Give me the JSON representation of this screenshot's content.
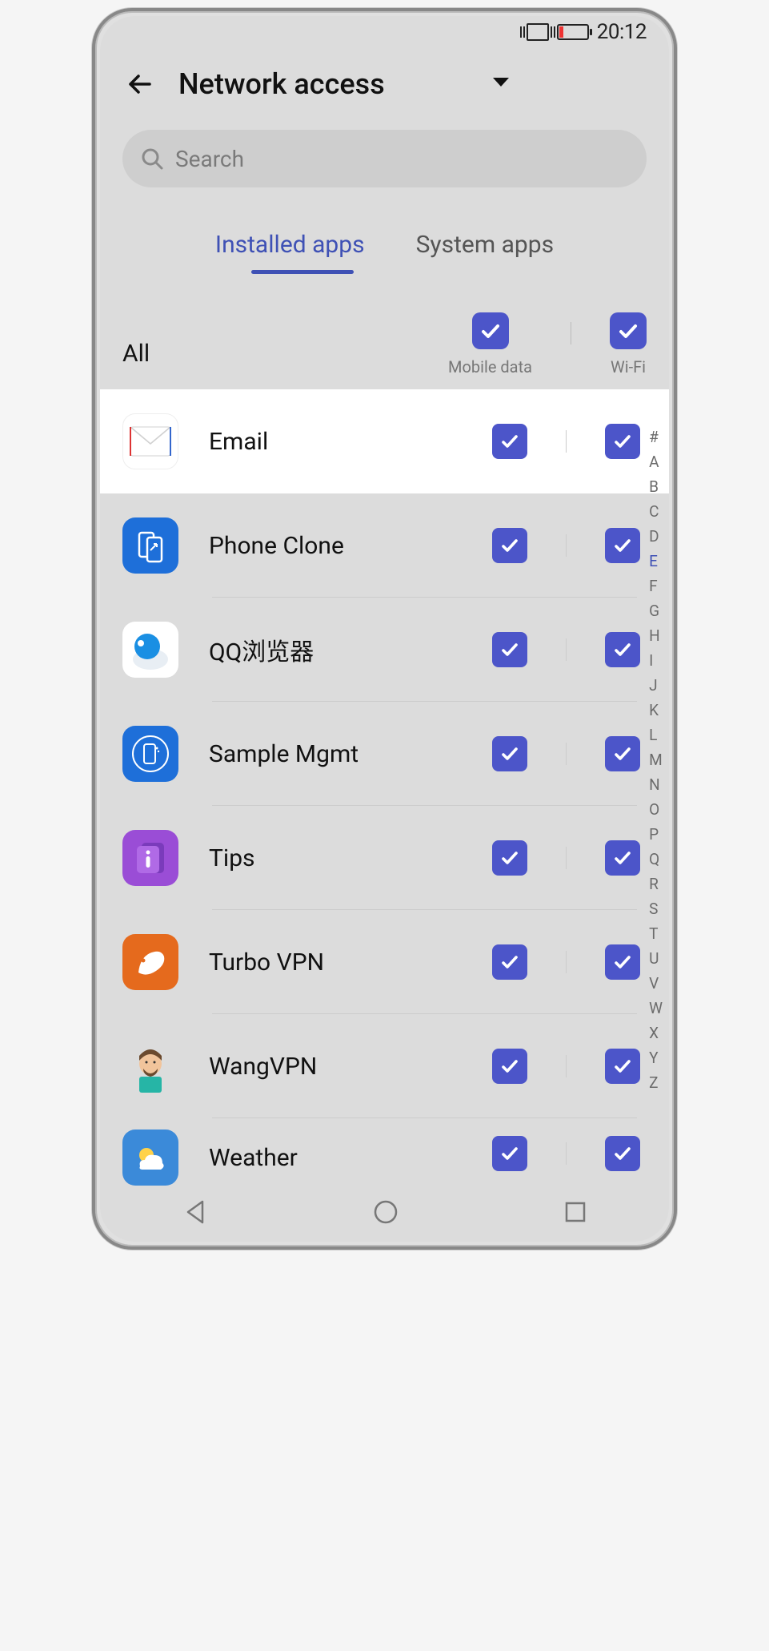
{
  "status": {
    "time": "20:12"
  },
  "header": {
    "title": "Network access"
  },
  "search": {
    "placeholder": "Search"
  },
  "tabs": {
    "installed": "Installed apps",
    "system": "System apps",
    "active": "installed"
  },
  "columns": {
    "all_label": "All",
    "mobile": "Mobile data",
    "wifi": "Wi-Fi",
    "all_mobile_checked": true,
    "all_wifi_checked": true
  },
  "apps": [
    {
      "name": "Email",
      "icon": "email",
      "mobile": true,
      "wifi": true,
      "highlight": true
    },
    {
      "name": "Phone Clone",
      "icon": "phoneclone",
      "mobile": true,
      "wifi": true
    },
    {
      "name": "QQ浏览器",
      "icon": "qq",
      "mobile": true,
      "wifi": true
    },
    {
      "name": "Sample Mgmt",
      "icon": "sample",
      "mobile": true,
      "wifi": true
    },
    {
      "name": "Tips",
      "icon": "tips",
      "mobile": true,
      "wifi": true
    },
    {
      "name": "Turbo VPN",
      "icon": "turbo",
      "mobile": true,
      "wifi": true
    },
    {
      "name": "WangVPN",
      "icon": "wang",
      "mobile": true,
      "wifi": true
    },
    {
      "name": "Weather",
      "icon": "weather",
      "mobile": true,
      "wifi": true
    }
  ],
  "az": {
    "letters": [
      "#",
      "A",
      "B",
      "C",
      "D",
      "E",
      "F",
      "G",
      "H",
      "I",
      "J",
      "K",
      "L",
      "M",
      "N",
      "O",
      "P",
      "Q",
      "R",
      "S",
      "T",
      "U",
      "V",
      "W",
      "X",
      "Y",
      "Z"
    ],
    "active": "E"
  }
}
